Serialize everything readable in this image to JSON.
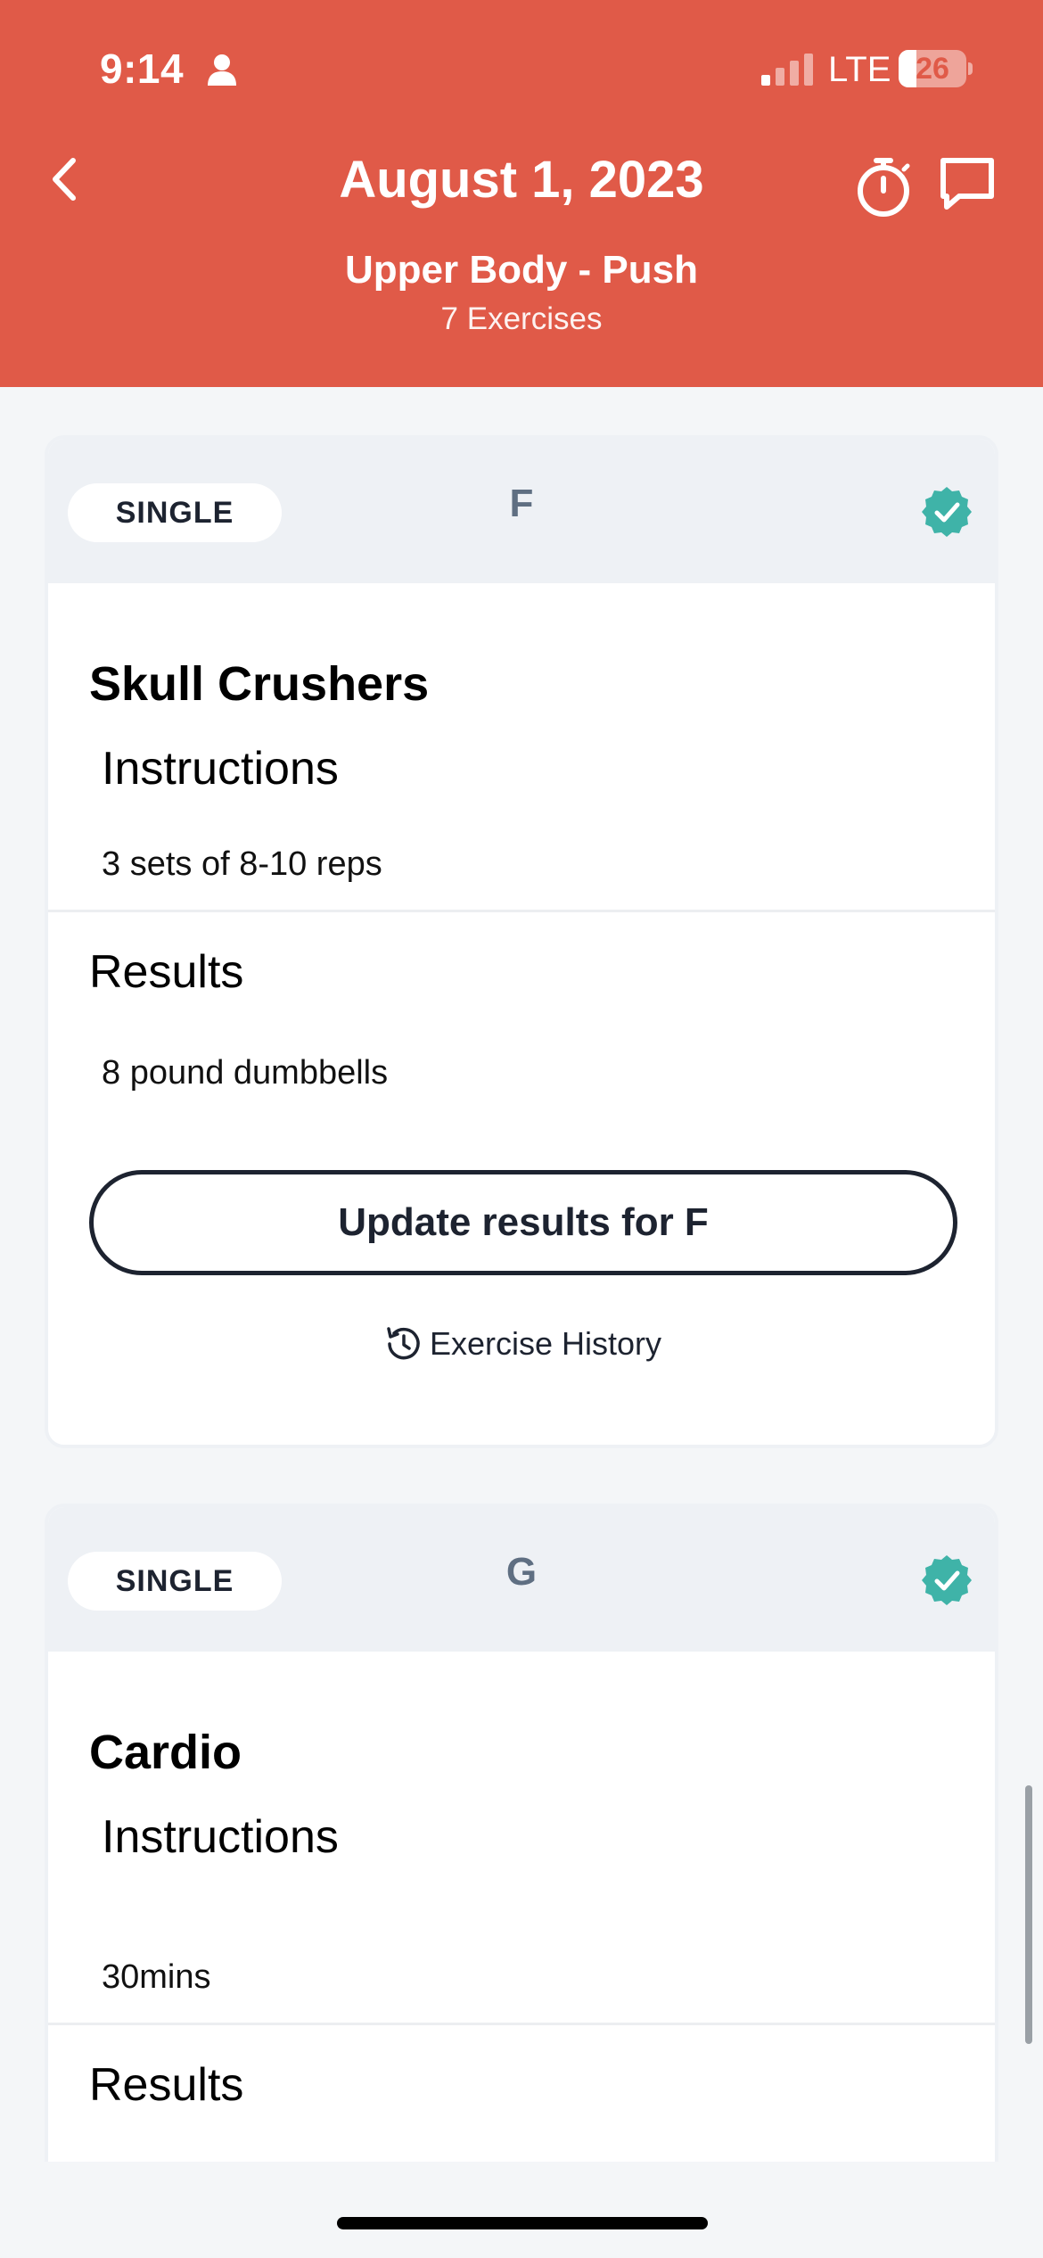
{
  "status_bar": {
    "time": "9:14",
    "network": "LTE",
    "battery": "26",
    "battery_level": 0.26
  },
  "header": {
    "title": "August 1, 2023",
    "workout_name": "Upper Body - Push",
    "exercise_count": "7 Exercises",
    "background_color": "#e05a48"
  },
  "cards": [
    {
      "type": "SINGLE",
      "letter": "F",
      "completed": true,
      "exercise_name": "Skull Crushers",
      "instructions_title": "Instructions",
      "instructions": "3 sets of 8-10 reps",
      "results_title": "Results",
      "results": "8 pound dumbbells",
      "update_button": "Update results for F",
      "history_link": "Exercise History"
    },
    {
      "type": "SINGLE",
      "letter": "G",
      "completed": true,
      "exercise_name": "Cardio",
      "instructions_title": "Instructions",
      "instructions": "30mins",
      "results_title": "Results"
    }
  ],
  "colors": {
    "accent": "#e05a48",
    "check": "#3fb3a8",
    "dark": "#1d2330"
  },
  "icons": {
    "back": "chevron-left-icon",
    "timer": "stopwatch-icon",
    "chat": "chat-bubble-icon",
    "completed": "verified-check-icon",
    "history": "history-clock-icon"
  }
}
